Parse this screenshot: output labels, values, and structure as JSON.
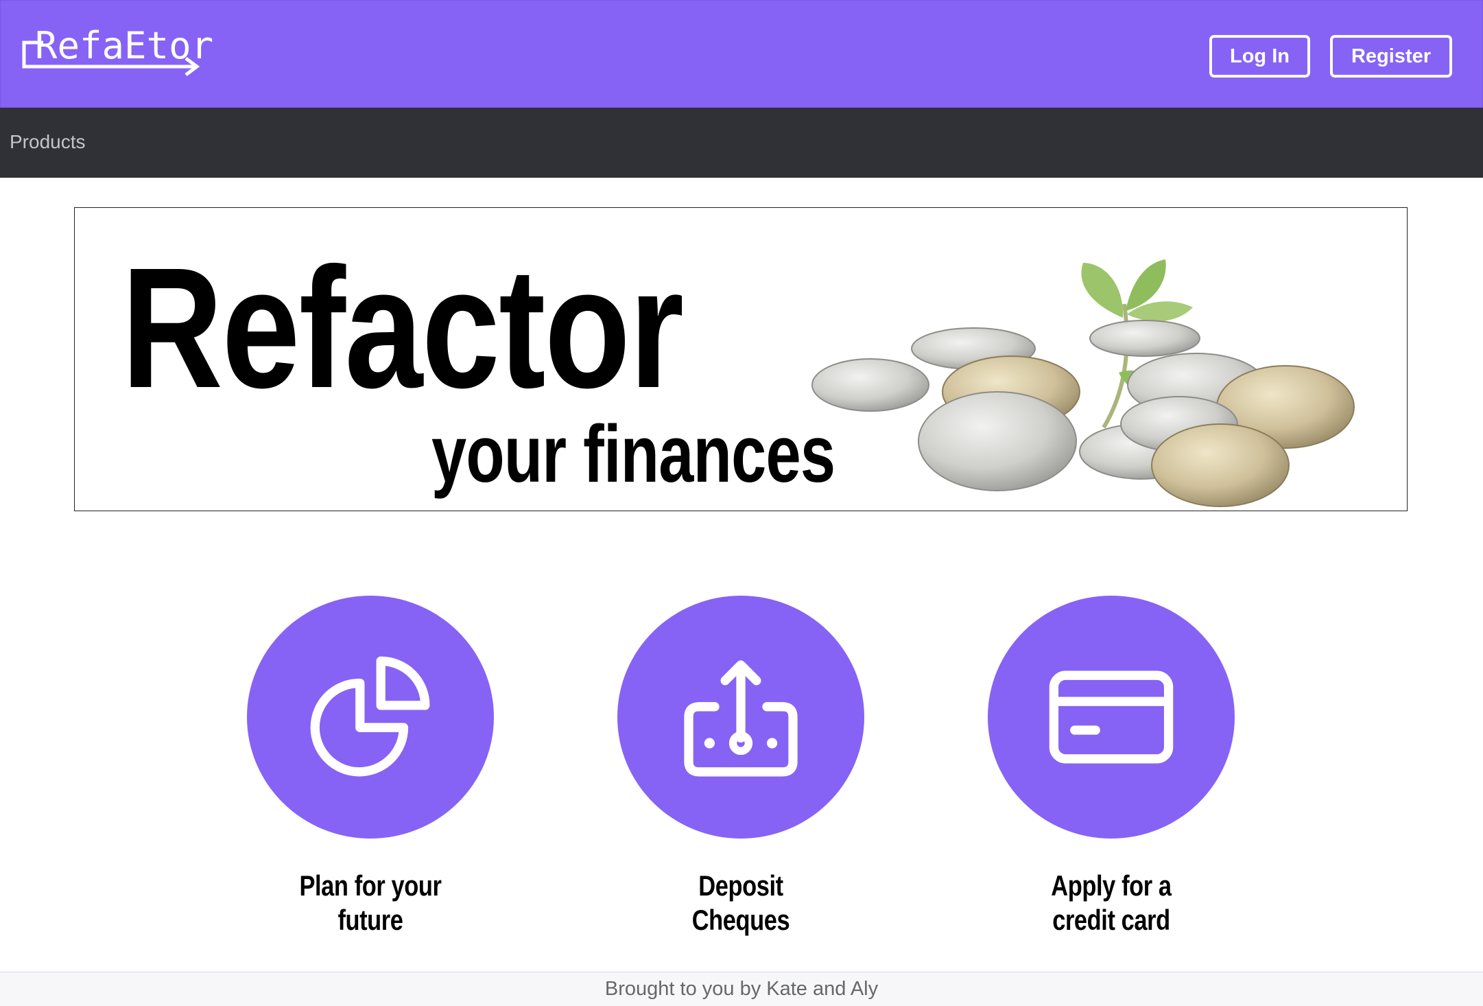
{
  "header": {
    "brand": "RefaEtor",
    "login_label": "Log In",
    "register_label": "Register"
  },
  "nav": {
    "items": [
      {
        "label": "Products"
      }
    ]
  },
  "banner": {
    "title": "Refactor",
    "subtitle": "your finances"
  },
  "features": [
    {
      "label_line1": "Plan for your",
      "label_line2": "future",
      "icon": "pie-chart-icon"
    },
    {
      "label_line1": "Deposit",
      "label_line2": "Cheques",
      "icon": "money-upload-icon"
    },
    {
      "label_line1": "Apply for a",
      "label_line2": "credit card",
      "icon": "credit-card-icon"
    }
  ],
  "footer": {
    "text": "Brought to you by Kate and Aly"
  },
  "colors": {
    "brand_purple": "#8663f5",
    "nav_dark": "#2f3136",
    "footer_bg": "#f7f7f9"
  }
}
